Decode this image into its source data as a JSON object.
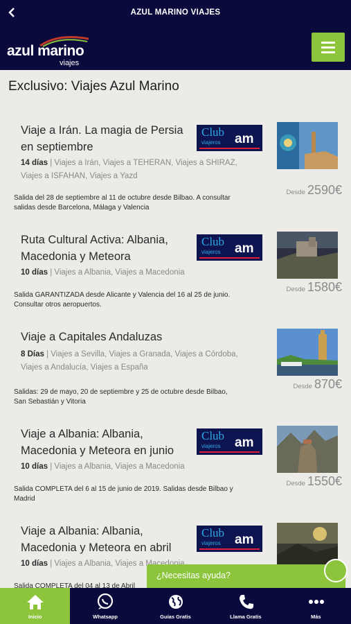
{
  "topbar": {
    "title": "AZUL MARINO VIAJES"
  },
  "logo": {
    "main": "azul marino",
    "sub": "viajes"
  },
  "page_title": "Exclusivo: Viajes Azul Marino",
  "badge": {
    "club": "Club",
    "viajeros": "viajeros",
    "am": "am"
  },
  "cards": [
    {
      "title": "Viaje a Irán. La magia de Persia en septiembre",
      "duration": "14 días",
      "tags": "Viajes a Irán, Viajes a TEHERAN, Viajes a SHIRAZ, Viajes a ISFAHAN, Viajes a Yazd",
      "note": "Salida del 28 de septiembre al 11 de octubre desde Bilbao. A consultar salidas desde Barcelona, Málaga y Valencia",
      "price_label": "Desde",
      "price": "2590€"
    },
    {
      "title": "Ruta Cultural Activa: Albania, Macedonia y Meteora",
      "duration": "10 días",
      "tags": "Viajes a Albania, Viajes a Macedonia",
      "note": "Salida GARANTIZADA desde Alicante y Valencia del 16 al 25 de junio. Consultar otros aeropuertos.",
      "price_label": "Desde",
      "price": "1580€"
    },
    {
      "title": "Viaje a Capitales Andaluzas",
      "duration": "8 Días",
      "tags": "Viajes a Sevilla, Viajes a Granada, Viajes a Córdoba, Viajes a Andalucía, Viajes a España",
      "note": "Salidas: 29 de mayo, 20 de septiembre y 25 de octubre desde Bilbao, San Sebastián y Vitoria",
      "price_label": "Desde",
      "price": "870€"
    },
    {
      "title": "Viaje a Albania: Albania, Macedonia y Meteora en junio",
      "duration": "10 días",
      "tags": "Viajes a Albania, Viajes a Macedonia",
      "note": "Salida COMPLETA del 6 al 15 de junio de 2019. Salidas desde Bilbao y Madrid",
      "price_label": "Desde",
      "price": "1550€"
    },
    {
      "title": "Viaje a Albania: Albania, Macedonia y Meteora en abril",
      "duration": "10 días",
      "tags": "Viajes a Albania, Viajes a Macedonia",
      "note": "Salida COMPLETA del 04 al 13 de Abril",
      "price_label": "",
      "price": ""
    }
  ],
  "help": {
    "text": "¿Necesitas ayuda?"
  },
  "nav": [
    {
      "label": "Inicio",
      "icon": "home-icon"
    },
    {
      "label": "Whatsapp",
      "icon": "whatsapp-icon"
    },
    {
      "label": "Guías Gratis",
      "icon": "globe-icon"
    },
    {
      "label": "Llama Gratis",
      "icon": "phone-icon"
    },
    {
      "label": "Más",
      "icon": "more-icon"
    }
  ],
  "colors": {
    "navy": "#0a0a3c",
    "green": "#8cc43c",
    "background": "#ecebe8"
  }
}
